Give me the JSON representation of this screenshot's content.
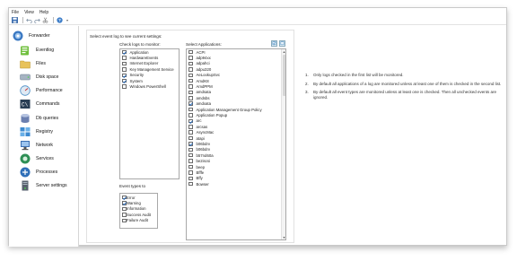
{
  "menu": [
    {
      "label": "File",
      "underline": "F"
    },
    {
      "label": "View",
      "underline": "V"
    },
    {
      "label": "Help",
      "underline": "H"
    }
  ],
  "toolbar": {
    "icons": [
      "save-icon",
      "undo-icon",
      "redo-icon",
      "cut-icon",
      "help-icon"
    ],
    "dropdown_glyph": "▾"
  },
  "sidebar": {
    "items": [
      {
        "label": "Forwarder",
        "icon": "forwarder-icon",
        "color": "#3a78c2"
      },
      {
        "label": "Eventlog",
        "icon": "eventlog-icon",
        "color": "#5aa630"
      },
      {
        "label": "Files",
        "icon": "files-icon",
        "color": "#e8c25a"
      },
      {
        "label": "Disk space",
        "icon": "disk-space-icon",
        "color": "#7a8fa3"
      },
      {
        "label": "Performance",
        "icon": "performance-icon",
        "color": "#4c8fc6"
      },
      {
        "label": "Commands",
        "icon": "commands-icon",
        "color": "#2a3f55"
      },
      {
        "label": "Db queries",
        "icon": "db-queries-icon",
        "color": "#6b7fb0"
      },
      {
        "label": "Registry",
        "icon": "registry-icon",
        "color": "#3d8ad0"
      },
      {
        "label": "Network",
        "icon": "network-icon",
        "color": "#3c6fb1"
      },
      {
        "label": "Services",
        "icon": "services-icon",
        "color": "#2e8f55"
      },
      {
        "label": "Processes",
        "icon": "processes-icon",
        "color": "#2f6fb8"
      },
      {
        "label": "Server settings",
        "icon": "server-settings-icon",
        "color": "#56606c"
      }
    ]
  },
  "panel": {
    "heading": "Select event log to see current settings:",
    "logs_caption": "Check logs to monitor:",
    "apps_caption": "Select Applications:",
    "event_types_caption": "Event types to",
    "logs": [
      {
        "label": "Application",
        "checked": true
      },
      {
        "label": "HardwareEvents",
        "checked": false
      },
      {
        "label": "Internet Explorer",
        "checked": false
      },
      {
        "label": "Key Management Service",
        "checked": false
      },
      {
        "label": "Security",
        "checked": true
      },
      {
        "label": "System",
        "checked": true
      },
      {
        "label": "Windows PowerShell",
        "checked": false
      }
    ],
    "event_types": [
      {
        "label": "Error",
        "checked": true
      },
      {
        "label": "Warning",
        "checked": true
      },
      {
        "label": "Information",
        "checked": false
      },
      {
        "label": "Success Audit",
        "checked": false
      },
      {
        "label": "Failure Audit",
        "checked": false
      }
    ],
    "applications": [
      {
        "label": "ACPI",
        "checked": false
      },
      {
        "label": "adp94xx",
        "checked": false
      },
      {
        "label": "adpahci",
        "checked": false
      },
      {
        "label": "adpu320",
        "checked": false
      },
      {
        "label": "AeLookupSvc",
        "checked": false
      },
      {
        "label": "AmdK8",
        "checked": false
      },
      {
        "label": "AmdPPM",
        "checked": false
      },
      {
        "label": "amdsata",
        "checked": false
      },
      {
        "label": "amdsbs",
        "checked": false
      },
      {
        "label": "amdxata",
        "checked": true
      },
      {
        "label": "Application Management Group Policy",
        "checked": false
      },
      {
        "label": "Application Popup",
        "checked": false
      },
      {
        "label": "arc",
        "checked": true
      },
      {
        "label": "arcsas",
        "checked": false
      },
      {
        "label": "AsyncMac",
        "checked": false
      },
      {
        "label": "atapi",
        "checked": false
      },
      {
        "label": "b06bdrv",
        "checked": true
      },
      {
        "label": "b06bdrv",
        "checked": false
      },
      {
        "label": "b57nd60a",
        "checked": false
      },
      {
        "label": "be2iscsi",
        "checked": false
      },
      {
        "label": "beep",
        "checked": false
      },
      {
        "label": "Bfffe",
        "checked": false
      },
      {
        "label": "Bffy",
        "checked": false
      },
      {
        "label": "Bowser",
        "checked": false
      }
    ],
    "select_all_glyph": "☑",
    "deselect_all_glyph": "☐",
    "scroll_up_glyph": "▲",
    "scroll_down_glyph": "▼"
  },
  "notes": [
    {
      "num": "1.",
      "text": "Only logs checked in the first list will be monitored."
    },
    {
      "num": "2.",
      "text": "By default all applications of a log are monitored unless at least one of them is checked in the second list."
    },
    {
      "num": "3.",
      "text": "By default all event types are monitored unless at least one is checked. Then all unchecked events are ignored."
    }
  ]
}
